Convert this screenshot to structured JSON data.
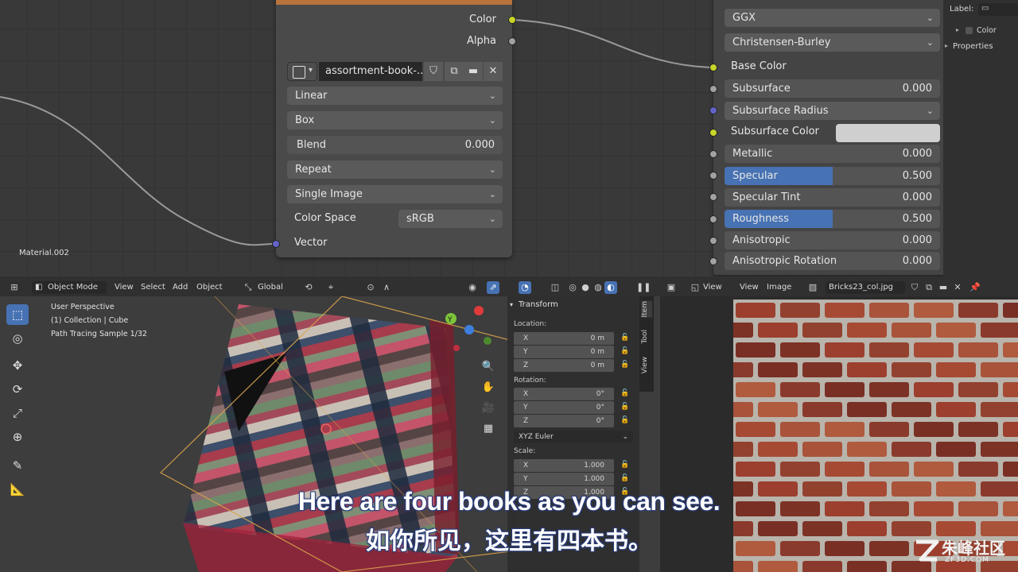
{
  "node_editor": {
    "material_name": "Material.002",
    "image_node": {
      "outputs": {
        "color": "Color",
        "alpha": "Alpha"
      },
      "image_name": "assortment-book-...",
      "interpolation": "Linear",
      "projection": "Box",
      "blend_label": "Blend",
      "blend_value": "0.000",
      "extension": "Repeat",
      "source": "Single Image",
      "color_space_label": "Color Space",
      "color_space_value": "sRGB",
      "vector_input": "Vector"
    },
    "bsdf_node": {
      "distribution": "GGX",
      "subsurface_method": "Christensen-Burley",
      "base_color": "Base Color",
      "subsurface": {
        "label": "Subsurface",
        "value": "0.000"
      },
      "subsurface_radius": "Subsurface Radius",
      "subsurface_color": "Subsurface Color",
      "metallic": {
        "label": "Metallic",
        "value": "0.000"
      },
      "specular": {
        "label": "Specular",
        "value": "0.500",
        "fraction": 0.5
      },
      "specular_tint": {
        "label": "Specular Tint",
        "value": "0.000"
      },
      "roughness": {
        "label": "Roughness",
        "value": "0.500",
        "fraction": 0.5
      },
      "anisotropic": {
        "label": "Anisotropic",
        "value": "0.000"
      },
      "anisotropic_rotation": {
        "label": "Anisotropic Rotation",
        "value": "0.000"
      }
    },
    "side_panel": {
      "label": "Label:",
      "color": "Color",
      "properties": "Properties"
    }
  },
  "viewport_header": {
    "mode": "Object Mode",
    "menus": [
      "View",
      "Select",
      "Add",
      "Object"
    ],
    "orientation": "Global"
  },
  "viewport": {
    "perspective": "User Perspective",
    "collection": "(1) Collection | Cube",
    "samples": "Path Tracing Sample 1/32"
  },
  "npanel": {
    "title": "Transform",
    "tabs": [
      "Item",
      "Tool",
      "View"
    ],
    "location_label": "Location:",
    "location": [
      {
        "axis": "X",
        "value": "0 m"
      },
      {
        "axis": "Y",
        "value": "0 m"
      },
      {
        "axis": "Z",
        "value": "0 m"
      }
    ],
    "rotation_label": "Rotation:",
    "rotation": [
      {
        "axis": "X",
        "value": "0°"
      },
      {
        "axis": "Y",
        "value": "0°"
      },
      {
        "axis": "Z",
        "value": "0°"
      }
    ],
    "rotation_mode": "XYZ Euler",
    "scale_label": "Scale:",
    "scale": [
      {
        "axis": "X",
        "value": "1.000"
      },
      {
        "axis": "Y",
        "value": "1.000"
      },
      {
        "axis": "Z",
        "value": "1.000"
      }
    ]
  },
  "image_editor_header": {
    "menus": [
      "View",
      "Image"
    ],
    "image_name": "Bricks23_col.jpg"
  },
  "subtitles": {
    "english": "Here are four books as you can see.",
    "chinese": "如你所见，这里有四本书。"
  },
  "watermark": {
    "name": "朱峰社区",
    "url": "ZF3D.COM"
  },
  "colors": {
    "accent_blue": "#4772b3",
    "node_header_orange": "#b9733d",
    "socket_yellow": "#c7d42a",
    "socket_purple": "#6363c7"
  }
}
